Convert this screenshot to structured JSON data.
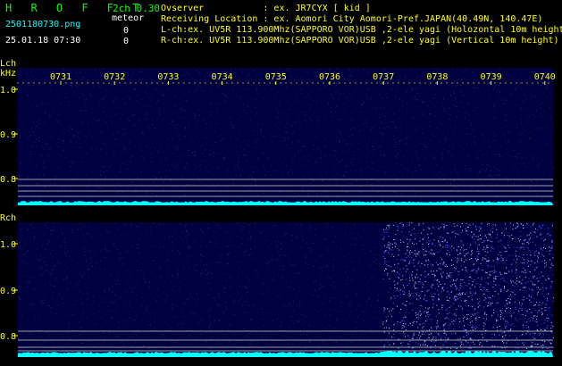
{
  "header": {
    "app_name": "H R O F F T",
    "version": "2ch 0.30",
    "filename": "2501180730.png",
    "datetime": "25.01.18 07:30",
    "meteor_label": "meteor",
    "meteor_l_count": "0",
    "meteor_r_count": "0",
    "info_lines": [
      "Ovserver           : ex. JR7CYX [ kid ]",
      "Receiving Location : ex. Aomori City Aomori-Pref.JAPAN(40.49N, 140.47E)",
      "L-ch:ex. UV5R 113.900Mhz(SAPPORO VOR)USB ,2-ele yagi (Holozontal 10m height)",
      "R-ch:ex. UV5R 113.900Mhz(SAPPORO VOR)USB ,2-ele yagi (Vertical 10m height)"
    ]
  },
  "chart_data": [
    {
      "type": "heatmap",
      "title": "Lch",
      "ylabel": "kHz",
      "x_ticks": [
        "0731",
        "0732",
        "0733",
        "0734",
        "0735",
        "0736",
        "0737",
        "0738",
        "0739",
        "0740"
      ],
      "y_ticks": [
        "1.0",
        "0.9",
        "0.8"
      ],
      "colors": {
        "background": "#000040",
        "signal": "#00ffff",
        "marker": "#ffff00"
      }
    },
    {
      "type": "heatmap",
      "title": "Rch",
      "y_ticks": [
        "1.0",
        "0.9",
        "0.8"
      ],
      "colors": {
        "background": "#000040",
        "signal": "#00ffff",
        "marker": "#ffff00"
      }
    }
  ]
}
